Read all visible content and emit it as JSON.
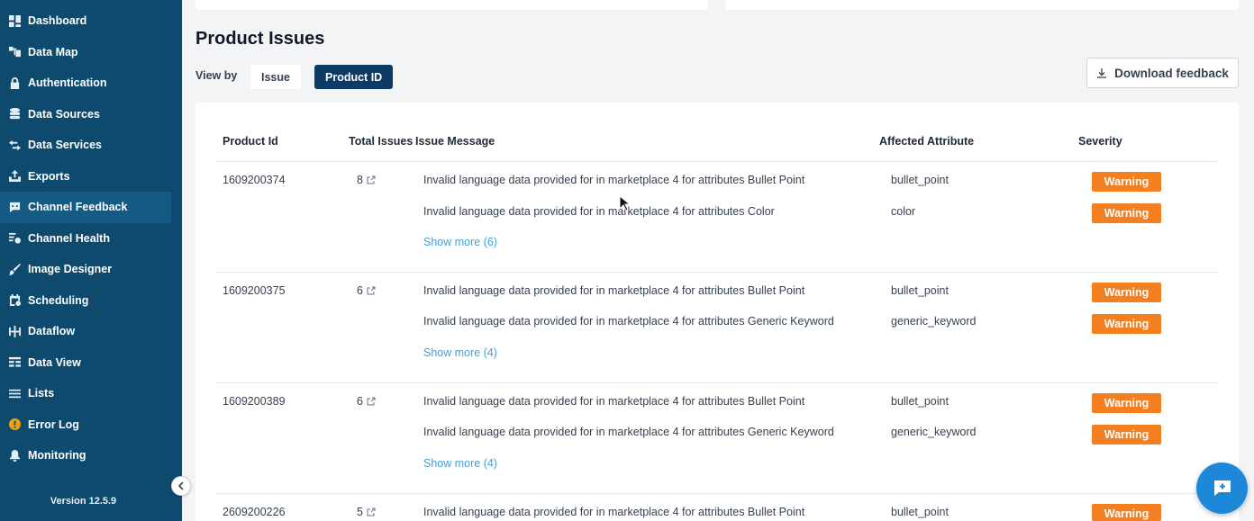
{
  "sidebar": {
    "items": [
      {
        "label": "Dashboard",
        "icon": "dashboard-icon"
      },
      {
        "label": "Data Map",
        "icon": "data-map-icon"
      },
      {
        "label": "Authentication",
        "icon": "lock-icon"
      },
      {
        "label": "Data Sources",
        "icon": "database-icon"
      },
      {
        "label": "Data Services",
        "icon": "transfer-icon"
      },
      {
        "label": "Exports",
        "icon": "export-icon"
      },
      {
        "label": "Channel Feedback",
        "icon": "chat-icon",
        "active": true
      },
      {
        "label": "Channel Health",
        "icon": "health-icon"
      },
      {
        "label": "Image Designer",
        "icon": "brush-icon"
      },
      {
        "label": "Scheduling",
        "icon": "calendar-icon"
      },
      {
        "label": "Dataflow",
        "icon": "dataflow-icon"
      },
      {
        "label": "Data View",
        "icon": "table-icon"
      },
      {
        "label": "Lists",
        "icon": "list-icon"
      },
      {
        "label": "Error Log",
        "icon": "error-icon"
      },
      {
        "label": "Monitoring",
        "icon": "bell-icon"
      }
    ],
    "version": "Version 12.5.9"
  },
  "page": {
    "title": "Product Issues",
    "view_by_label": "View by",
    "view_options": [
      "Issue",
      "Product ID"
    ],
    "selected_view": "Product ID",
    "download_label": "Download feedback"
  },
  "table": {
    "headers": [
      "Product Id",
      "Total Issues",
      "Issue Message",
      "Affected Attribute",
      "Severity"
    ],
    "rows": [
      {
        "id": "1609200374",
        "total": "8",
        "issues": [
          {
            "message": "Invalid language data provided for in marketplace 4 for attributes Bullet Point",
            "attribute": "bullet_point",
            "severity": "Warning"
          },
          {
            "message": "Invalid language data provided for in marketplace 4 for attributes Color",
            "attribute": "color",
            "severity": "Warning"
          }
        ],
        "show_more": "Show more (6)"
      },
      {
        "id": "1609200375",
        "total": "6",
        "issues": [
          {
            "message": "Invalid language data provided for in marketplace 4 for attributes Bullet Point",
            "attribute": "bullet_point",
            "severity": "Warning"
          },
          {
            "message": "Invalid language data provided for in marketplace 4 for attributes Generic Keyword",
            "attribute": "generic_keyword",
            "severity": "Warning"
          }
        ],
        "show_more": "Show more (4)"
      },
      {
        "id": "1609200389",
        "total": "6",
        "issues": [
          {
            "message": "Invalid language data provided for in marketplace 4 for attributes Bullet Point",
            "attribute": "bullet_point",
            "severity": "Warning"
          },
          {
            "message": "Invalid language data provided for in marketplace 4 for attributes Generic Keyword",
            "attribute": "generic_keyword",
            "severity": "Warning"
          }
        ],
        "show_more": "Show more (4)"
      },
      {
        "id": "2609200226",
        "total": "5",
        "issues": [
          {
            "message": "Invalid language data provided for in marketplace 4 for attributes Bullet Point",
            "attribute": "bullet_point",
            "severity": "Warning"
          }
        ]
      }
    ]
  },
  "colors": {
    "sidebar_bg": "#0e4a6e",
    "primary_button": "#0e3b66",
    "warning": "#f47f20",
    "link": "#3fa0d8",
    "fab": "#1e88d8"
  }
}
